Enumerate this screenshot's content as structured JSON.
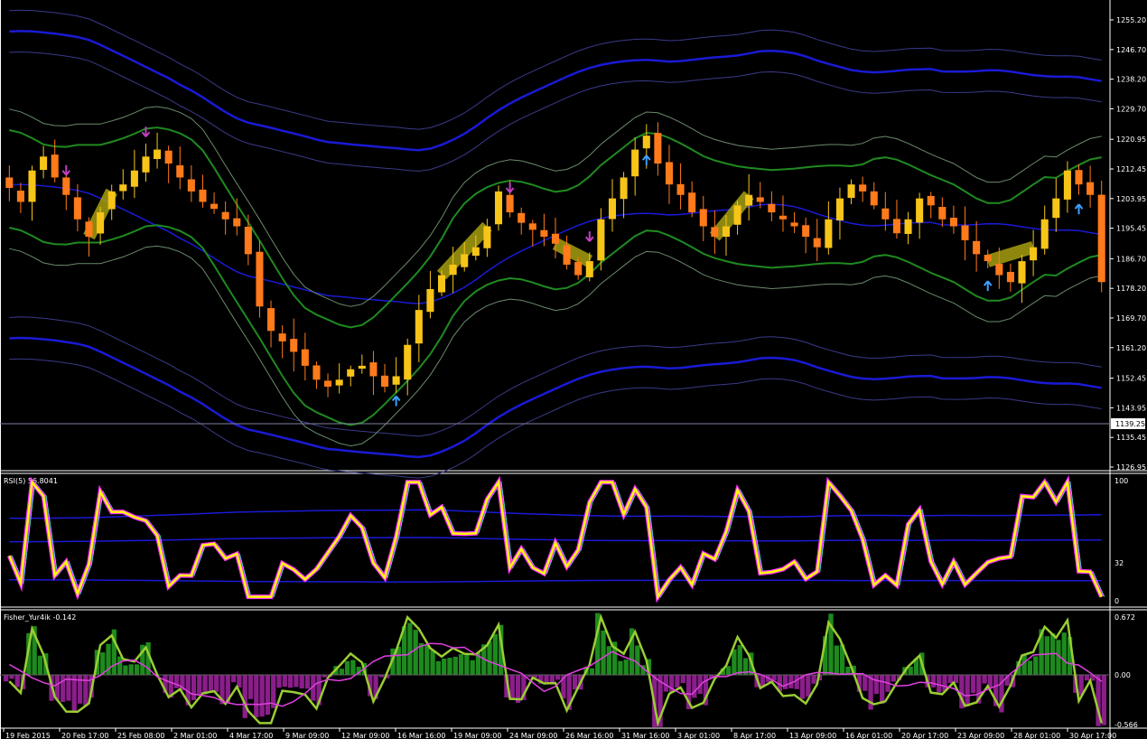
{
  "colors": {
    "background": "#000000",
    "candle_up": "#f7c418",
    "candle_down": "#ff7a1a",
    "keltner_outer": "#1a1ad6",
    "keltner_inner": "#3a3a8a",
    "bollinger": "#1f8a1f",
    "bollinger_outer": "#6a8a6a",
    "highlight": "#b0aa10",
    "arrow_up": "#3fa0ff",
    "arrow_down": "#c040c0",
    "rsi_main": "#ffff00",
    "rsi_shadow": "#ff30ff",
    "rsi_cyan": "#40e0e0",
    "rsi_band": "#1a1ad6",
    "fisher_line": "#9acd32",
    "fisher_signal": "#e040e0",
    "fisher_hist_pos": "#1e8a1e",
    "fisher_hist_neg": "#8a1e8a"
  },
  "main": {
    "price_ticks": [
      "1255.20",
      "1246.70",
      "1238.20",
      "1229.70",
      "1220.95",
      "1212.45",
      "1203.95",
      "1195.45",
      "1186.70",
      "1178.20",
      "1169.70",
      "1161.20",
      "1152.45",
      "1143.95",
      "1135.45",
      "1126.95"
    ],
    "current_price": "1139.25"
  },
  "rsi": {
    "title": "RSI(5) 56.8041",
    "ticks": [
      "100",
      "32",
      "0"
    ]
  },
  "fisher": {
    "title": "Fisher_Yur4ik -0.142",
    "ticks": [
      "0.672",
      "0.00",
      "-0.566"
    ]
  },
  "time_axis": {
    "labels": [
      "19 Feb 2015",
      "20 Feb 17:00",
      "25 Feb 08:00",
      "2 Mar 01:00",
      "4 Mar 17:00",
      "9 Mar 09:00",
      "12 Mar 09:00",
      "16 Mar 16:00",
      "19 Mar 09:00",
      "24 Mar 09:00",
      "26 Mar 16:00",
      "31 Mar 16:00",
      "3 Apr 01:00",
      "8 Apr 17:00",
      "13 Apr 09:00",
      "16 Apr 01:00",
      "20 Apr 17:00",
      "23 Apr 09:00",
      "28 Apr 01:00",
      "30 Apr 17:00"
    ]
  },
  "chart_data": {
    "type": "candlestick",
    "series": [
      {
        "name": "Price",
        "values": [
          1207,
          1203,
          1212,
          1216,
          1210,
          1205,
          1198,
          1193,
          1200,
          1206,
          1208,
          1212,
          1216,
          1218,
          1214,
          1210,
          1206,
          1203,
          1201,
          1198,
          1196,
          1188,
          1173,
          1166,
          1163,
          1160,
          1156,
          1152,
          1150,
          1152,
          1155,
          1156,
          1153,
          1150,
          1153,
          1162,
          1172,
          1178,
          1182,
          1185,
          1188,
          1190,
          1196,
          1206,
          1200,
          1197,
          1195,
          1193,
          1191,
          1185,
          1182,
          1186,
          1198,
          1204,
          1210,
          1218,
          1222,
          1214,
          1208,
          1205,
          1200,
          1196,
          1193,
          1196,
          1202,
          1205,
          1203,
          1200,
          1198,
          1196,
          1193,
          1190,
          1198,
          1204,
          1208,
          1206,
          1202,
          1198,
          1194,
          1198,
          1204,
          1202,
          1198,
          1196,
          1192,
          1188,
          1186,
          1182,
          1180,
          1186,
          1190,
          1198,
          1204,
          1212,
          1208,
          1205,
          1180
        ]
      }
    ]
  }
}
